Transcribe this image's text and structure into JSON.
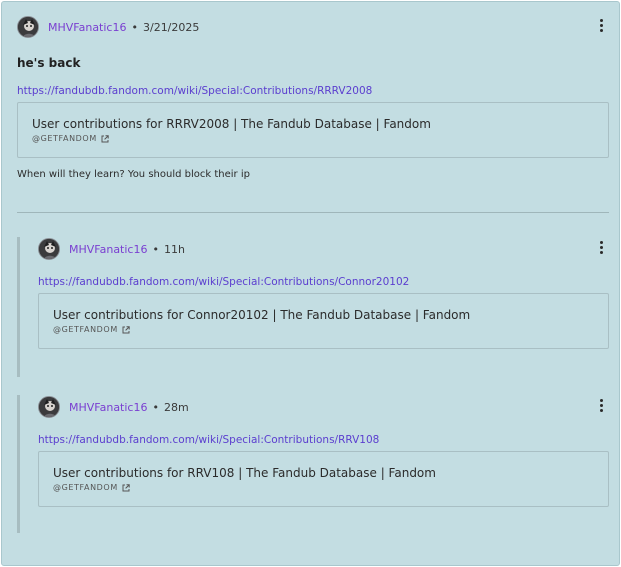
{
  "post": {
    "username": "MHVFanatic16",
    "separator": "•",
    "timestamp": "3/21/2025",
    "title": "he's back",
    "link": "https://fandubdb.fandom.com/wiki/Special:Contributions/RRRV2008",
    "preview_title": "User contributions for RRRV2008 | The Fandub Database | Fandom",
    "preview_source": "@GETFANDOM",
    "body": "When will they learn? You should block their ip"
  },
  "replies": [
    {
      "username": "MHVFanatic16",
      "separator": "•",
      "timestamp": "11h",
      "link": "https://fandubdb.fandom.com/wiki/Special:Contributions/Connor20102",
      "preview_title": "User contributions for Connor20102 | The Fandub Database | Fandom",
      "preview_source": "@GETFANDOM"
    },
    {
      "username": "MHVFanatic16",
      "separator": "•",
      "timestamp": "28m",
      "link": "https://fandubdb.fandom.com/wiki/Special:Contributions/RRV108",
      "preview_title": "User contributions for RRV108 | The Fandub Database | Fandom",
      "preview_source": "@GETFANDOM"
    }
  ],
  "colors": {
    "background": "#c3dde2",
    "username": "#7a3fd1",
    "link": "#5b3ecf",
    "border": "#a9bfc4"
  },
  "icons": {
    "menu": "more-vertical-icon",
    "external": "external-link-icon",
    "avatar": "user-avatar"
  }
}
